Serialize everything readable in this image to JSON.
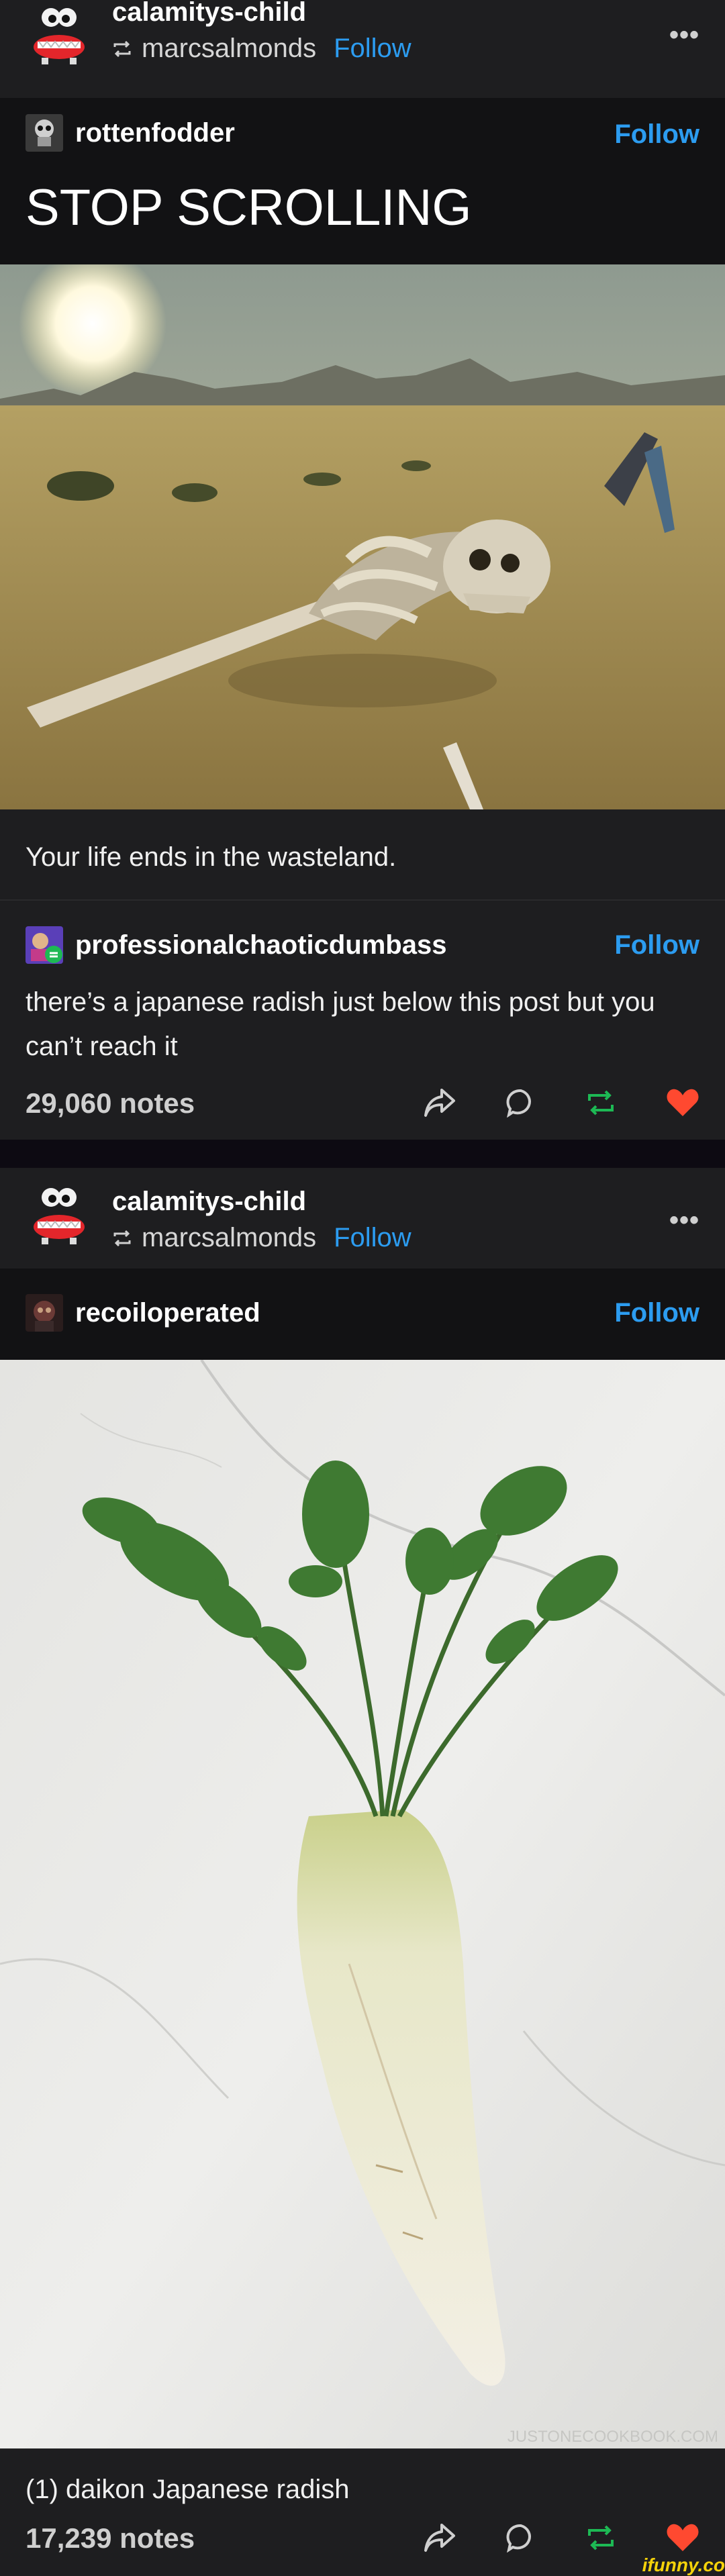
{
  "posts": [
    {
      "reblogger": "calamitys-child",
      "reblogged_from": "marcsalmonds",
      "follow_label": "Follow",
      "original_blog": "rottenfodder",
      "original_follow": "Follow",
      "title": "STOP SCROLLING",
      "caption": "Your life ends in the wasteland.",
      "reply_blog": "professionalchaoticdumbass",
      "reply_follow": "Follow",
      "reply_text": "there’s a japanese radish just below this post but you can’t reach it",
      "notes": "29,060 notes"
    },
    {
      "reblogger": "calamitys-child",
      "reblogged_from": "marcsalmonds",
      "follow_label": "Follow",
      "original_blog": "recoiloperated",
      "original_follow": "Follow",
      "image_watermark": "JUSTONECOOKBOOK.COM",
      "caption": "(1) daikon Japanese radish",
      "notes": "17,239 notes"
    }
  ],
  "site_watermark": "ifunny.co",
  "more_label": "•••"
}
